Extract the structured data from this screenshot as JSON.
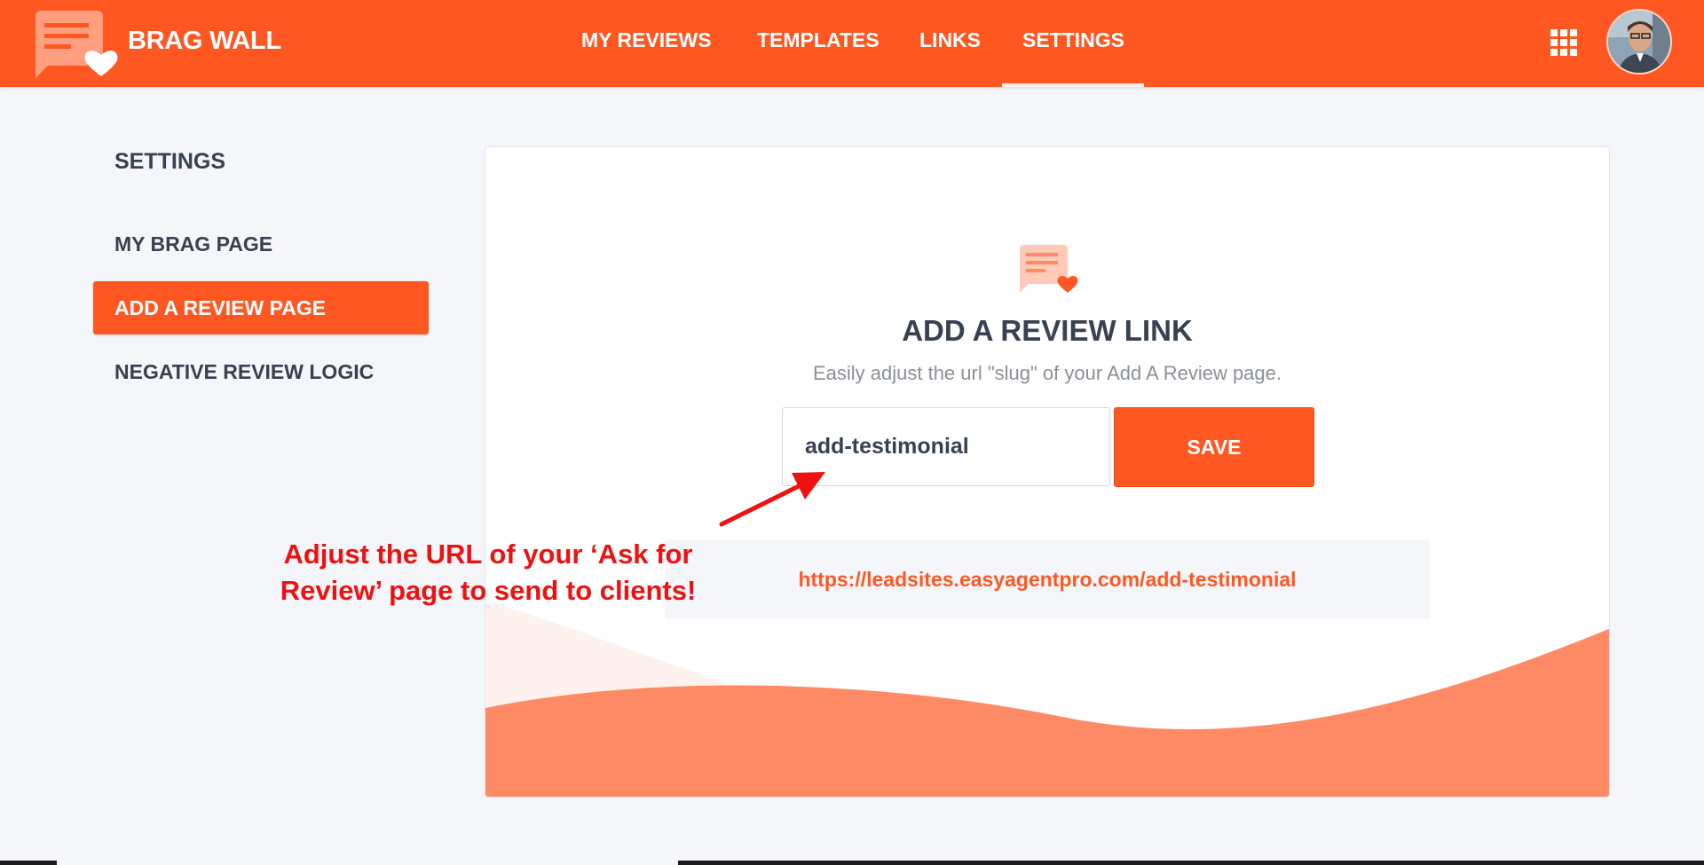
{
  "app": {
    "brand": "BRAG WALL",
    "accent_color": "#ff5722"
  },
  "nav": {
    "items": [
      {
        "label": "MY REVIEWS"
      },
      {
        "label": "TEMPLATES"
      },
      {
        "label": "LINKS"
      },
      {
        "label": "SETTINGS",
        "active": true
      }
    ]
  },
  "header_icons": {
    "apps": "grid-apps-icon",
    "profile": "avatar"
  },
  "sidebar": {
    "title": "SETTINGS",
    "items": [
      {
        "label": "MY BRAG PAGE"
      },
      {
        "label": "ADD A REVIEW PAGE",
        "active": true
      },
      {
        "label": "NEGATIVE REVIEW LOGIC"
      }
    ]
  },
  "card": {
    "icon": "review-chat-heart-icon",
    "title": "ADD A REVIEW LINK",
    "subtitle": "Easily adjust the url \"slug\" of your Add A Review page.",
    "slug_value": "add-testimonial",
    "save_label": "SAVE",
    "url": "https://leadsites.easyagentpro.com/add-testimonial"
  },
  "annotation": {
    "line1": "Adjust the URL of your ‘Ask for",
    "line2": "Review’ page to send to clients!",
    "color": "#ee1111"
  }
}
